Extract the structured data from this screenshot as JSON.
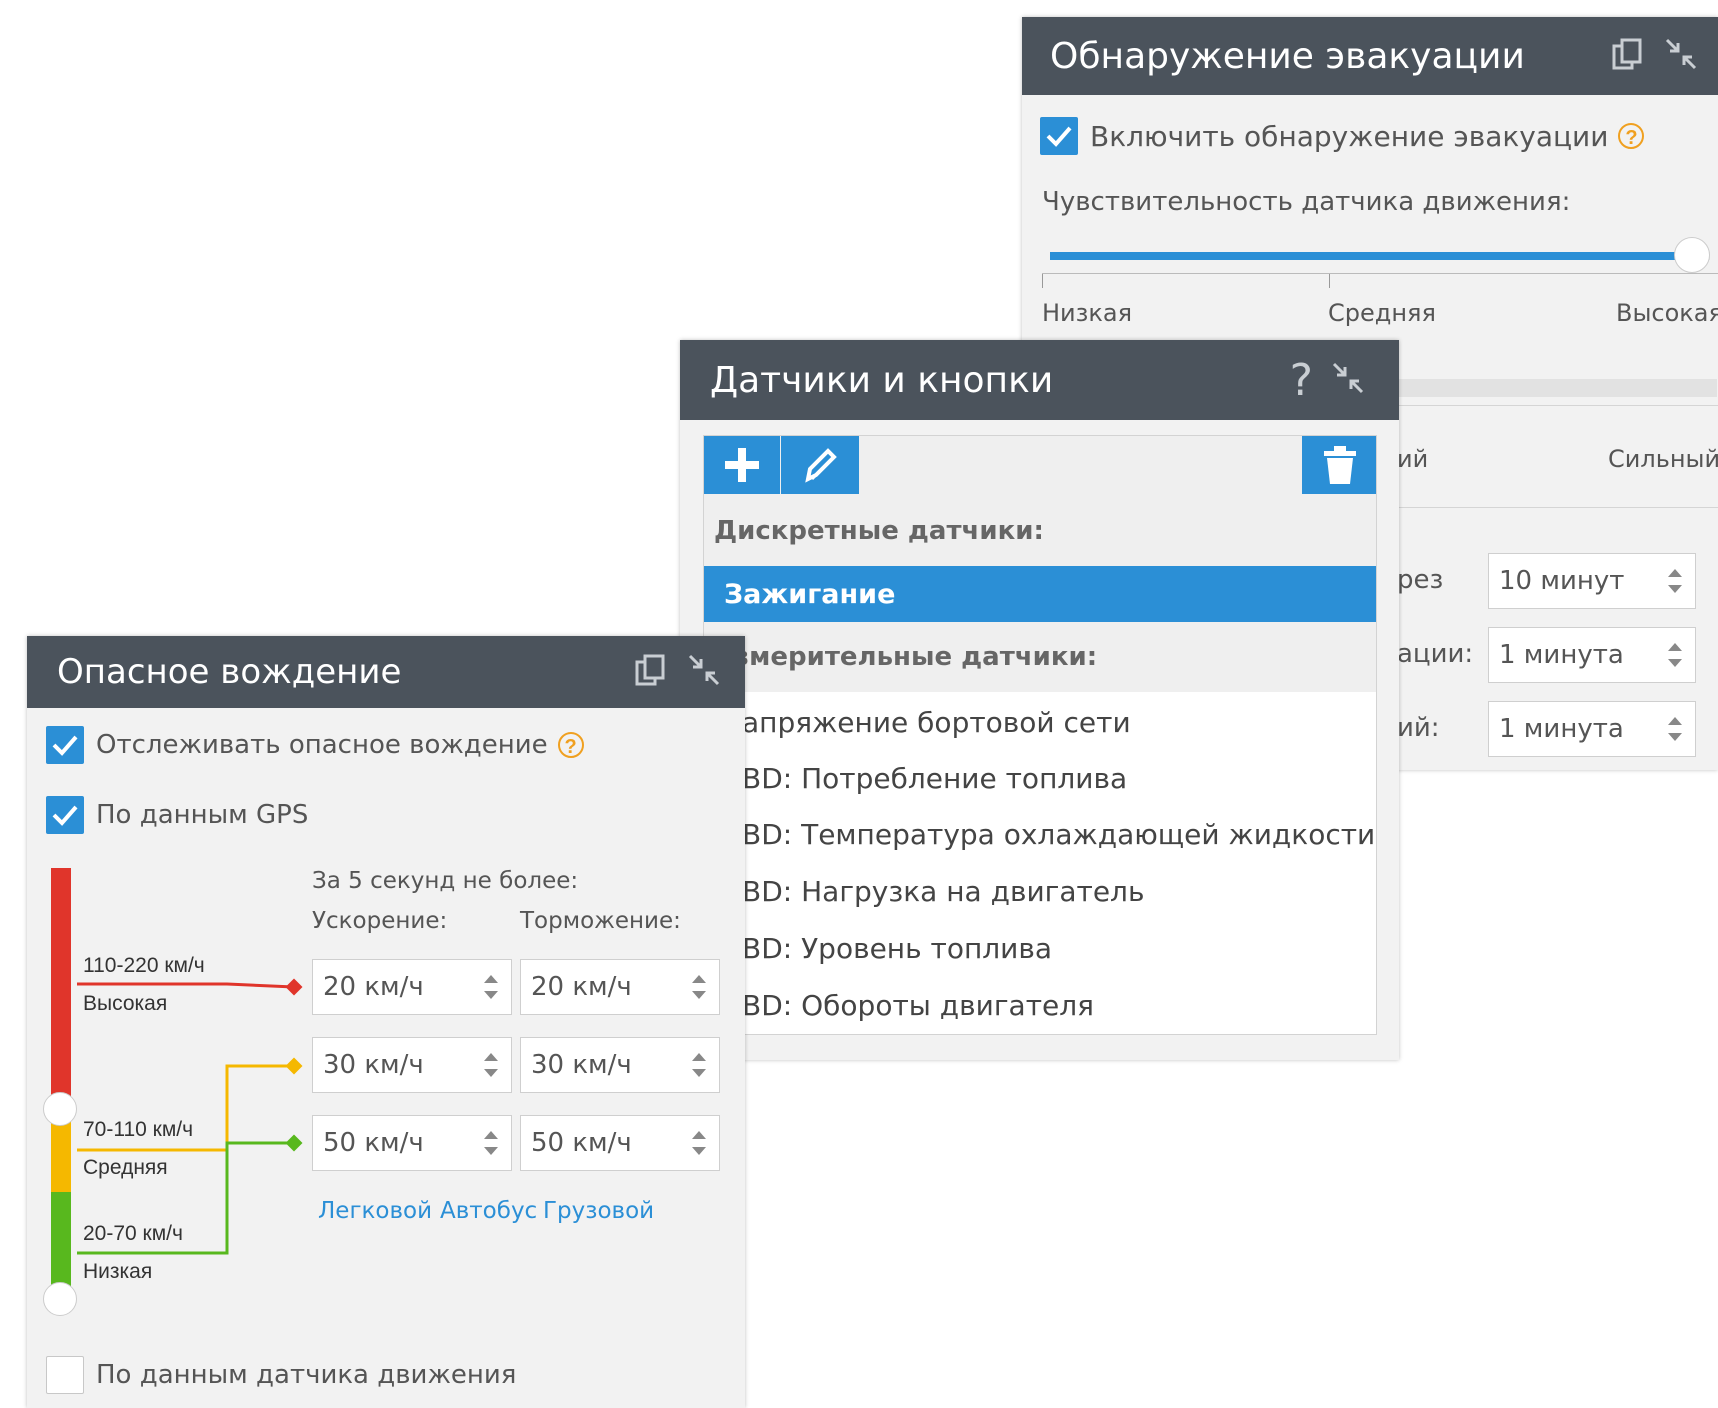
{
  "evacuation": {
    "title": "Обнаружение эвакуации",
    "enable_label": "Включить обнаружение эвакуации",
    "sensitivity_label": "Чувствительность датчика движения:",
    "ticks": [
      "Низкая",
      "Средняя",
      "Высокая"
    ],
    "sensitivity_level": 1.0,
    "partial_tick_right": "Сильный",
    "partial_tick_left": "ий",
    "partial_label_1": "рез",
    "partial_label_2": "ации:",
    "partial_label_3": "ий:",
    "field_1_value": "10  минут",
    "field_2_value": "1  минута",
    "field_3_value": "1  минута"
  },
  "sensors": {
    "title": "Датчики и кнопки",
    "help_glyph": "?",
    "discrete_header": "Дискретные датчики:",
    "discrete_items": [
      "Зажигание"
    ],
    "measuring_header": "змерительные датчики:",
    "measuring_items": [
      "апряжение бортовой сети",
      "BD: Потребление топлива",
      "BD: Температура охлаждающей жидкости",
      "BD: Нагрузка на двигатель",
      "BD: Уровень топлива",
      "BD: Обороты двигателя"
    ]
  },
  "driving": {
    "title": "Опасное вождение",
    "track_label": "Отслеживать опасное вождение",
    "gps_label": "По данным GPS",
    "period_label": "За 5 секунд не более:",
    "accel_header": "Ускорение:",
    "brake_header": "Торможение:",
    "levels": [
      {
        "range": "110-220 км/ч",
        "name": "Высокая",
        "accel": "20  км/ч",
        "brake": "20  км/ч",
        "color": "#e0352b"
      },
      {
        "range": "70-110 км/ч",
        "name": "Средняя",
        "accel": "30  км/ч",
        "brake": "30  км/ч",
        "color": "#f5b800"
      },
      {
        "range": "20-70 км/ч",
        "name": "Низкая",
        "accel": "50  км/ч",
        "brake": "50  км/ч",
        "color": "#58b81e"
      }
    ],
    "presets": [
      "Легковой",
      "Автобус",
      "Грузовой"
    ],
    "motion_label": "По данным датчика движения"
  },
  "colors": {
    "accent": "#2b8fd6",
    "header": "#4b535c",
    "help": "#f0a020"
  }
}
